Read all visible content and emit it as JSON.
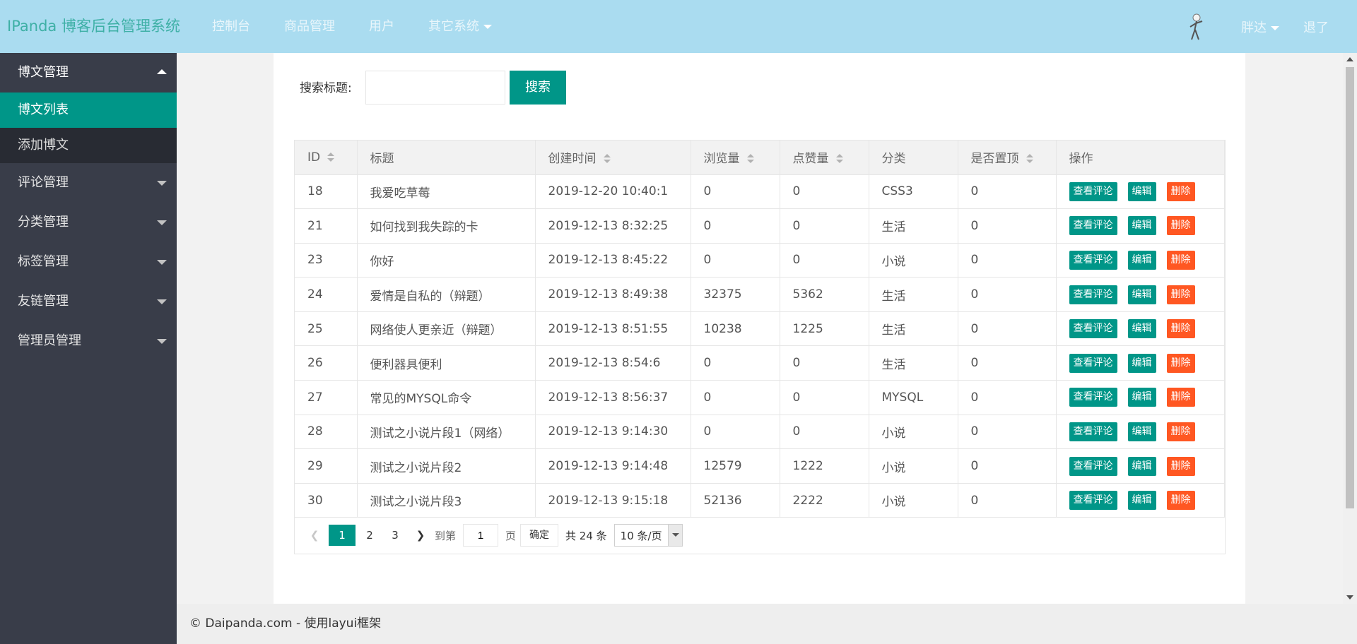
{
  "header": {
    "logo": "IPanda 博客后台管理系统",
    "nav": [
      "控制台",
      "商品管理",
      "用户",
      "其它系统"
    ],
    "user": {
      "name": "胖达",
      "logout": "退了"
    }
  },
  "sidebar": {
    "groups": [
      {
        "label": "博文管理",
        "expanded": true,
        "children": [
          "博文列表",
          "添加博文"
        ],
        "active_child": "博文列表"
      },
      {
        "label": "评论管理"
      },
      {
        "label": "分类管理"
      },
      {
        "label": "标签管理"
      },
      {
        "label": "友链管理"
      },
      {
        "label": "管理员管理"
      }
    ]
  },
  "search": {
    "label": "搜索标题:",
    "value": "",
    "button": "搜索"
  },
  "table": {
    "columns": [
      "ID",
      "标题",
      "创建时间",
      "浏览量",
      "点赞量",
      "分类",
      "是否置顶",
      "操作"
    ],
    "actions": {
      "view_comments": "查看评论",
      "edit": "编辑",
      "delete": "删除"
    },
    "rows": [
      [
        "18",
        "我爱吃草莓",
        "2019-12-20 10:40:1",
        "0",
        "0",
        "CSS3",
        "0"
      ],
      [
        "21",
        "如何找到我失踪的卡",
        "2019-12-13 8:32:25",
        "0",
        "0",
        "生活",
        "0"
      ],
      [
        "23",
        "你好",
        "2019-12-13 8:45:22",
        "0",
        "0",
        "小说",
        "0"
      ],
      [
        "24",
        "爱情是自私的（辩题）",
        "2019-12-13 8:49:38",
        "32375",
        "5362",
        "生活",
        "0"
      ],
      [
        "25",
        "网络使人更亲近（辩题）",
        "2019-12-13 8:51:55",
        "10238",
        "1225",
        "生活",
        "0"
      ],
      [
        "26",
        "便利器具便利",
        "2019-12-13 8:54:6",
        "0",
        "0",
        "生活",
        "0"
      ],
      [
        "27",
        "常见的MYSQL命令",
        "2019-12-13 8:56:37",
        "0",
        "0",
        "MYSQL",
        "0"
      ],
      [
        "28",
        "测试之小说片段1（网络）",
        "2019-12-13 9:14:30",
        "0",
        "0",
        "小说",
        "0"
      ],
      [
        "29",
        "测试之小说片段2",
        "2019-12-13 9:14:48",
        "12579",
        "1222",
        "小说",
        "0"
      ],
      [
        "30",
        "测试之小说片段3",
        "2019-12-13 9:15:18",
        "52136",
        "2222",
        "小说",
        "0"
      ]
    ]
  },
  "pager": {
    "pages": [
      "1",
      "2",
      "3"
    ],
    "current": "1",
    "goto_label": "到第",
    "goto_value": "1",
    "page_unit": "页",
    "confirm": "确定",
    "total": "共 24 条",
    "limit": "10 条/页"
  },
  "footer": {
    "text": "© Daipanda.com - 使用layui框架"
  }
}
